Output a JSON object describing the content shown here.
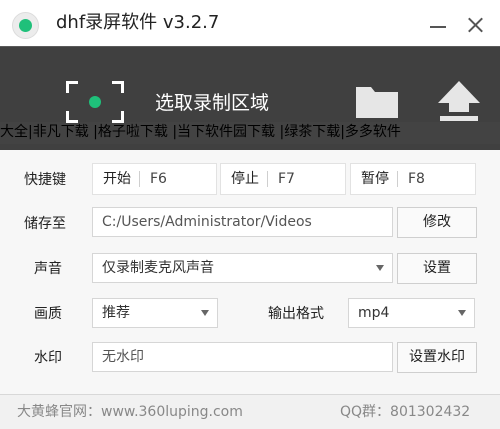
{
  "window": {
    "title": "dhf录屏软件 v3.2.7"
  },
  "toolbar": {
    "select_region_label": "选取录制区域",
    "record_icon": "record-region-icon",
    "folder_icon": "folder-icon",
    "upload_icon": "upload-icon",
    "banner_text": "大全|非凡下载 |格子啦下载 |当下软件园下载 |绿茶下载|多多软件"
  },
  "hotkeys": {
    "label": "快捷键",
    "start_label": "开始",
    "start_key": "F6",
    "stop_label": "停止",
    "stop_key": "F7",
    "pause_label": "暂停",
    "pause_key": "F8"
  },
  "save": {
    "label": "储存至",
    "path": "C:/Users/Administrator/Videos",
    "modify_button": "修改"
  },
  "audio": {
    "label": "声音",
    "selected": "仅录制麦克风声音",
    "settings_button": "设置"
  },
  "quality": {
    "label": "画质",
    "selected": "推荐",
    "format_label": "输出格式",
    "format_selected": "mp4"
  },
  "watermark": {
    "label": "水印",
    "value": "无水印",
    "settings_button": "设置水印"
  },
  "footer": {
    "website": "大黄蜂官网：www.360luping.com",
    "qq_group": "QQ群：801302432"
  },
  "colors": {
    "accent": "#1fc07a",
    "toolbar_bg": "#404040"
  }
}
